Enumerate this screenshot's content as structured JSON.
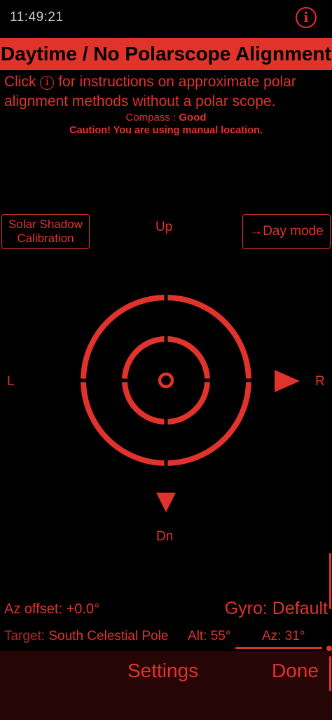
{
  "status": {
    "time": "11:49:21"
  },
  "header": {
    "info_icon": "info-circle-icon",
    "info_glyph": "i",
    "title": "Daytime / No Polarscope Alignment"
  },
  "instructions": {
    "prefix": "Click",
    "icon_glyph": "i",
    "suffix": "for instructions on approximate polar alignment methods without a polar scope."
  },
  "compass": {
    "label": "Compass :",
    "value": "Good"
  },
  "caution": "Caution! You are using manual location.",
  "buttons": {
    "solar_shadow": "Solar Shadow Calibration",
    "day_mode": "→Day mode"
  },
  "directions": {
    "up": "Up",
    "down": "Dn",
    "left": "L",
    "right": "R"
  },
  "readouts": {
    "az_offset": "Az offset: +0.0°",
    "gyro_label": "Gyro:",
    "gyro_value": "Default",
    "target_label": "Target:",
    "target_value": "South Celestial Pole",
    "alt": "Alt: 55°",
    "az_label": "Az:",
    "az_value": "31°"
  },
  "bottom": {
    "settings": "Settings",
    "done": "Done"
  },
  "colors": {
    "accent": "#e0332c",
    "background": "#000000",
    "bottom_bar": "#250505"
  }
}
